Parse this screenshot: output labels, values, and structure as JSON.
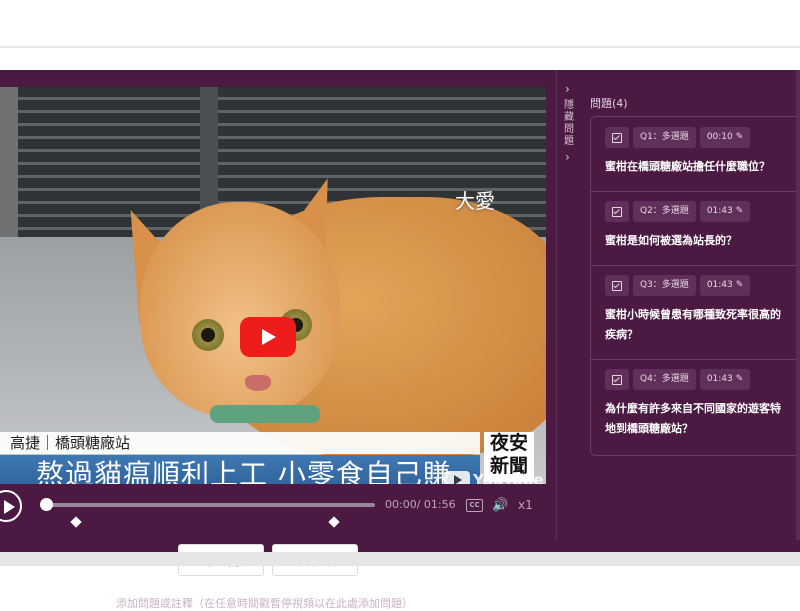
{
  "video": {
    "logo_text": "大愛",
    "caption_top": "高捷｜橋頭糖廠站",
    "caption_main": "熬過貓瘟順利上工 小零食自己賺",
    "caption_right": "夜安 新聞",
    "watermark": "YouTube"
  },
  "player": {
    "time": "00:00/ 01:56",
    "cc_label": "CC",
    "speed": "x1",
    "progress_fraction": 0.0
  },
  "actions": {
    "add_question": "+ 添加問題",
    "add_note": "新增註釋",
    "hint": "添加問題或註釋（在任意時間戳暫停視頻以在此處添加問題）"
  },
  "sidebar": {
    "collapse_label": "隱藏問題",
    "questions_title": "問題(4)",
    "questions": [
      {
        "type": "Q1：多選題",
        "time": "00:10",
        "text": "蜜柑在橋頭糖廠站擔任什麼職位？"
      },
      {
        "type": "Q2：多選題",
        "time": "01:43",
        "text": "蜜柑是如何被選為站長的？"
      },
      {
        "type": "Q3：多選題",
        "time": "01:43",
        "text": "蜜柑小時候曾患有哪種致死率很高的疾病？"
      },
      {
        "type": "Q4：多選題",
        "time": "01:43",
        "text": "為什麼有許多來自不同國家的遊客特地到橋頭糖廠站？"
      }
    ]
  }
}
